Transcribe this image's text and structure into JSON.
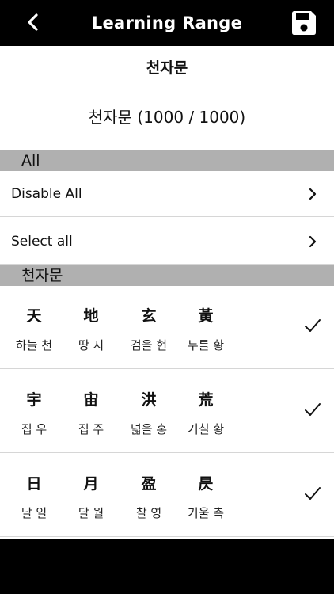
{
  "header": {
    "title": "Learning Range",
    "back_icon": "chevron-left-icon",
    "save_icon": "floppy-disk-icon"
  },
  "book": {
    "name": "천자문",
    "count": "천자문 (1000 / 1000)"
  },
  "sections": {
    "all_header": "All",
    "book_header": "천자문"
  },
  "options": [
    {
      "label": "Disable All"
    },
    {
      "label": "Select all"
    }
  ],
  "char_rows": [
    {
      "checked": true,
      "chars": [
        {
          "hanja": "天",
          "reading": "하늘 천"
        },
        {
          "hanja": "地",
          "reading": "땅 지"
        },
        {
          "hanja": "玄",
          "reading": "검을 현"
        },
        {
          "hanja": "黃",
          "reading": "누를 황"
        }
      ]
    },
    {
      "checked": true,
      "chars": [
        {
          "hanja": "宇",
          "reading": "집 우"
        },
        {
          "hanja": "宙",
          "reading": "집 주"
        },
        {
          "hanja": "洪",
          "reading": "넓을 홍"
        },
        {
          "hanja": "荒",
          "reading": "거칠 황"
        }
      ]
    },
    {
      "checked": true,
      "chars": [
        {
          "hanja": "日",
          "reading": "날 일"
        },
        {
          "hanja": "月",
          "reading": "달 월"
        },
        {
          "hanja": "盈",
          "reading": "찰 영"
        },
        {
          "hanja": "昃",
          "reading": "기울 측"
        }
      ]
    }
  ],
  "colors": {
    "topbar": "#000000",
    "section_header": "#b0b0b0"
  }
}
